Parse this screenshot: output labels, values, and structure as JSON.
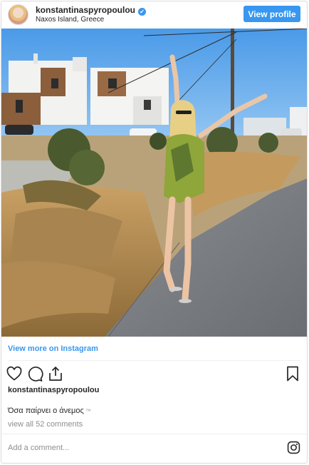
{
  "header": {
    "username": "konstantinaspyropoulou",
    "verified": "✔",
    "location": "Naxos Island, Greece",
    "view_profile_label": "View profile"
  },
  "post": {
    "view_more_label": "View more on Instagram",
    "poster": "konstantinaspyropoulou",
    "caption": "Όσα παίρνει ο άνεμος",
    "caption_tag": "™",
    "comments_label": "view all 52 comments"
  },
  "comment_box": {
    "placeholder": "Add a comment..."
  },
  "icons": {
    "like": "heart-icon",
    "comment": "comment-icon",
    "share": "share-icon",
    "save": "bookmark-icon",
    "instagram": "instagram-logo-icon"
  },
  "colors": {
    "accent": "#3897f0",
    "text": "#262626",
    "muted": "#8e8e8e",
    "border": "#dbdbdb"
  }
}
